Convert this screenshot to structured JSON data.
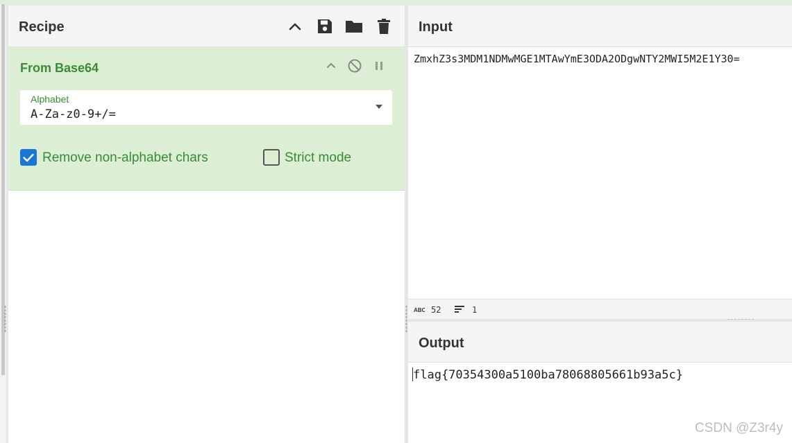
{
  "recipe": {
    "title": "Recipe",
    "actions": [
      "chevron-up-icon",
      "save-icon",
      "folder-icon",
      "trash-icon"
    ]
  },
  "operation": {
    "title": "From Base64",
    "alphabet_label": "Alphabet",
    "alphabet_value": "A-Za-z0-9+/=",
    "remove_label": "Remove non-alphabet chars",
    "remove_checked": true,
    "strict_label": "Strict mode",
    "strict_checked": false
  },
  "input": {
    "title": "Input",
    "text": "ZmxhZ3s3MDM1NDMwMGE1MTAwYmE3ODA2ODgwNTY2MWI5M2E1Y30=",
    "char_count": "52",
    "line_count": "1"
  },
  "output": {
    "title": "Output",
    "text": "flag{70354300a5100ba78068805661b93a5c}"
  },
  "watermark": "CSDN @Z3r4y",
  "colors": {
    "accent_green": "#3a8a37",
    "op_background": "#dcefd4",
    "checkbox_blue": "#1976d2"
  }
}
